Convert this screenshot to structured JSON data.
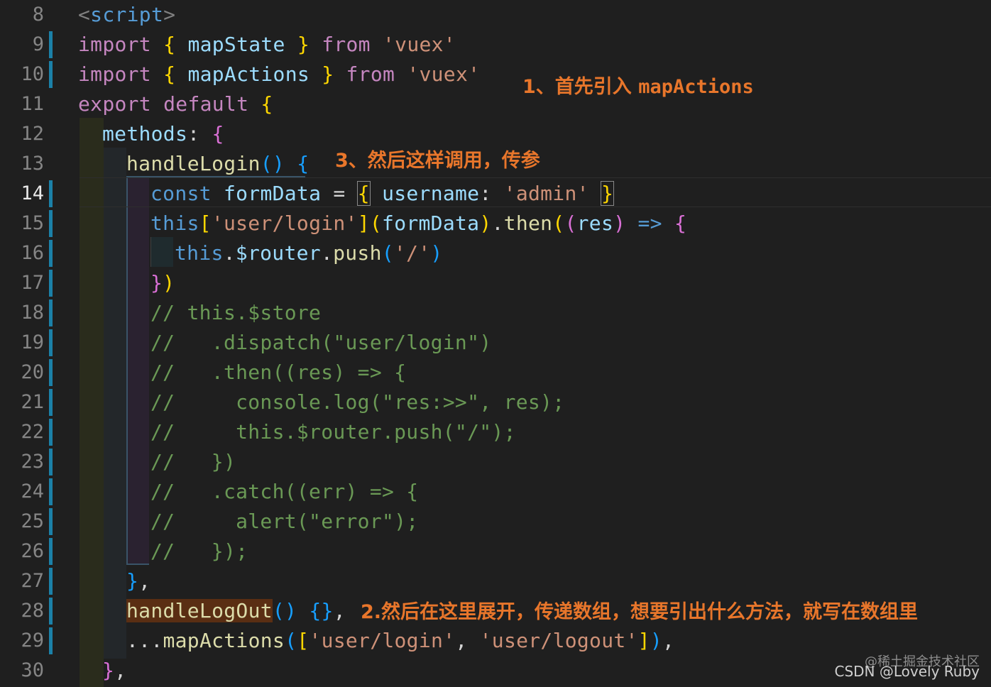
{
  "editor": {
    "active_line": "14",
    "lines": [
      {
        "num": "8"
      },
      {
        "num": "9"
      },
      {
        "num": "10"
      },
      {
        "num": "11"
      },
      {
        "num": "12"
      },
      {
        "num": "13"
      },
      {
        "num": "14"
      },
      {
        "num": "15"
      },
      {
        "num": "16"
      },
      {
        "num": "17"
      },
      {
        "num": "18"
      },
      {
        "num": "19"
      },
      {
        "num": "20"
      },
      {
        "num": "21"
      },
      {
        "num": "22"
      },
      {
        "num": "23"
      },
      {
        "num": "24"
      },
      {
        "num": "25"
      },
      {
        "num": "26"
      },
      {
        "num": "27"
      },
      {
        "num": "28"
      },
      {
        "num": "29"
      },
      {
        "num": "30"
      }
    ],
    "code": {
      "l8": [
        "<",
        "script",
        ">"
      ],
      "l9": [
        "import",
        " ",
        "{",
        " mapState ",
        "}",
        " from ",
        "'vuex'"
      ],
      "l10": [
        "import",
        " ",
        "{",
        " mapActions ",
        "}",
        " from ",
        "'vuex'"
      ],
      "l11": [
        "export",
        " ",
        "default",
        " ",
        "{"
      ],
      "l12": [
        "methods",
        ": ",
        "{"
      ],
      "l13": [
        "handleLogin",
        "()",
        " ",
        "{"
      ],
      "l14": [
        "const",
        " ",
        "formData",
        " = ",
        "{",
        " ",
        "username",
        ": ",
        "'admin'",
        " ",
        "}"
      ],
      "l15": [
        "this",
        "[",
        "'user/login'",
        "]",
        "(",
        "formData",
        ")",
        ".",
        "then",
        "(",
        "(",
        "res",
        ")",
        " ",
        "=>",
        " ",
        "{"
      ],
      "l16": [
        "this",
        ".",
        "$router",
        ".",
        "push",
        "(",
        "'/'",
        ")"
      ],
      "l17": [
        "}",
        ")"
      ],
      "l18": "// this.$store",
      "l19": "//   .dispatch(\"user/login\")",
      "l20": "//   .then((res) => {",
      "l21": "//     console.log(\"res:>>\", res);",
      "l22": "//     this.$router.push(\"/\");",
      "l23": "//   })",
      "l24": "//   .catch((err) => {",
      "l25": "//     alert(\"error\");",
      "l26": "//   });",
      "l27": [
        "}",
        ","
      ],
      "l28": [
        "handleLogOut",
        "()",
        " ",
        "{}",
        ","
      ],
      "l29": [
        "...",
        "mapActions",
        "(",
        "[",
        "'user/login'",
        ", ",
        "'user/logout'",
        "]",
        ")",
        ","
      ],
      "l30": [
        "}",
        ","
      ]
    }
  },
  "annotations": {
    "a1_prefix": "1、首先引入 ",
    "a1_code": "mapActions",
    "a2": "2.然后在这里展开，传递数组，想要引出什么方法，就写在数组里",
    "a3": "3、然后这样调用，传参"
  },
  "watermark": {
    "line1": "@稀土掘金技术社区",
    "line2": "CSDN @Lovely Ruby"
  },
  "colors": {
    "background": "#1f1f1f",
    "annotation": "#e8762b",
    "git_modified_bar": "#1b81a8",
    "keyword": "#c586c0",
    "string": "#ce9178",
    "comment": "#6a9955"
  }
}
